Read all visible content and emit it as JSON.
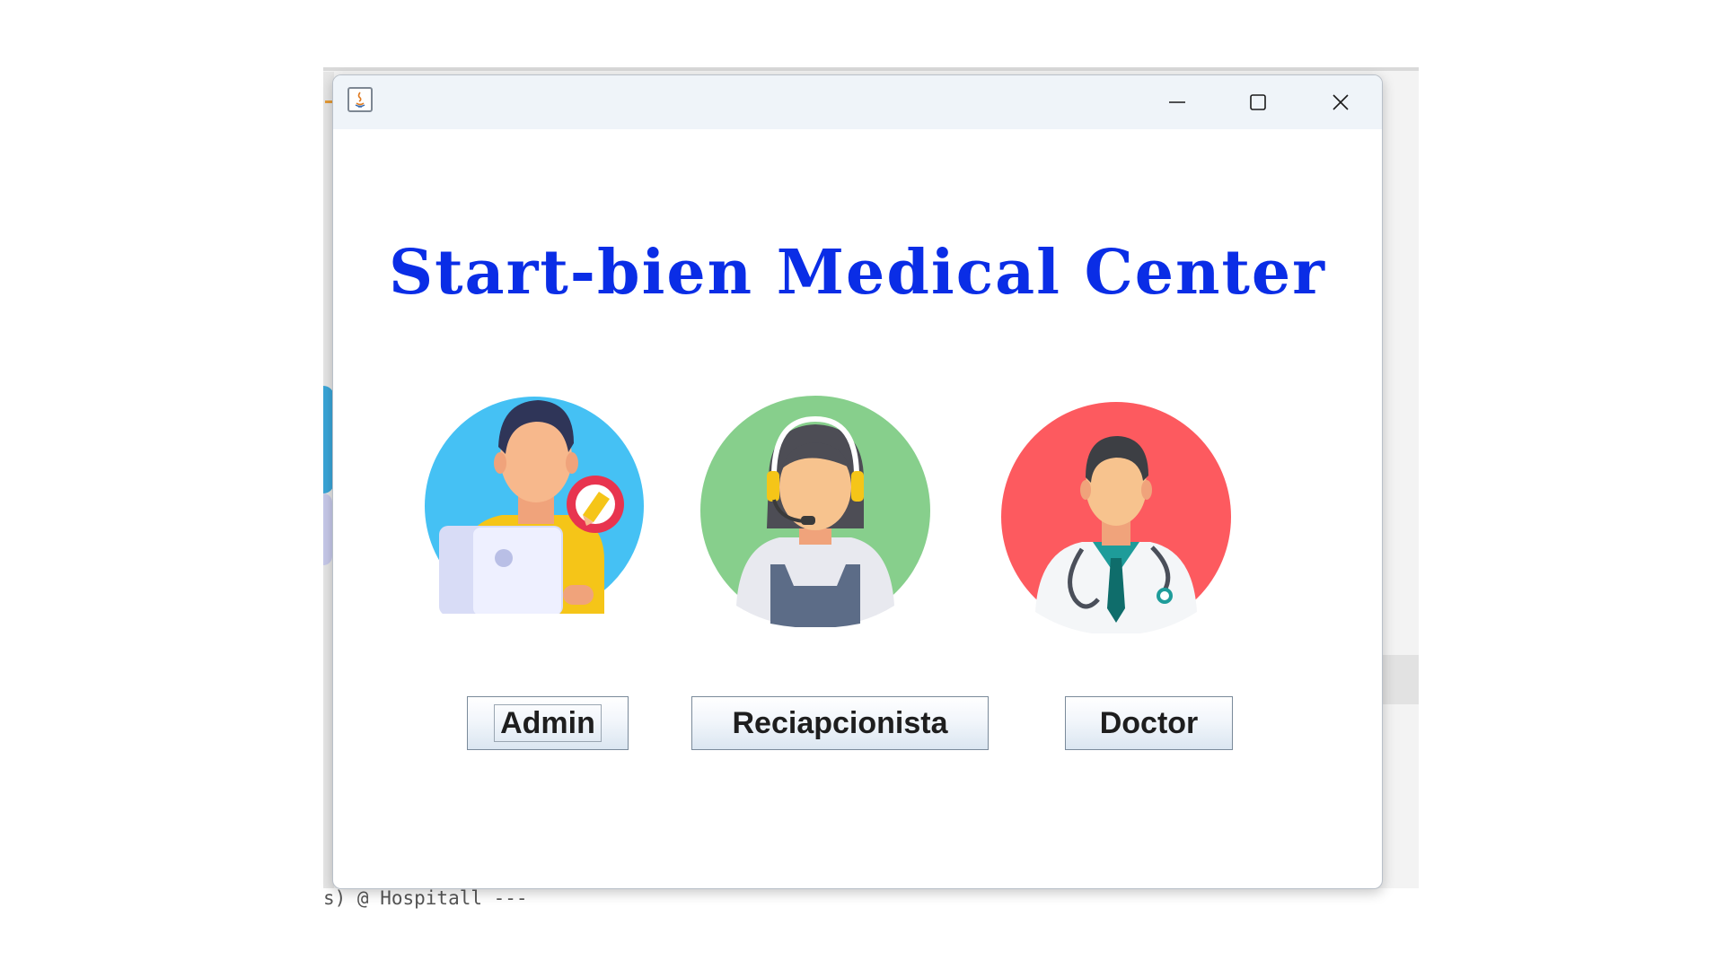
{
  "window": {
    "title": "",
    "controls": {
      "minimize": "minimize-icon",
      "maximize": "maximize-icon",
      "close": "close-icon"
    }
  },
  "header": {
    "title": "Start-bien Medical Center",
    "title_color": "#0a2de6"
  },
  "roles": [
    {
      "label": "Admin",
      "icon": "admin-icon",
      "circle_color": "#45c1f4"
    },
    {
      "label": "Reciapcionista",
      "icon": "receptionist-icon",
      "circle_color": "#87cf8c"
    },
    {
      "label": "Doctor",
      "icon": "doctor-icon",
      "circle_color": "#fd5a5f"
    }
  ],
  "background": {
    "console_text": "s) @ Hospitall ---"
  }
}
